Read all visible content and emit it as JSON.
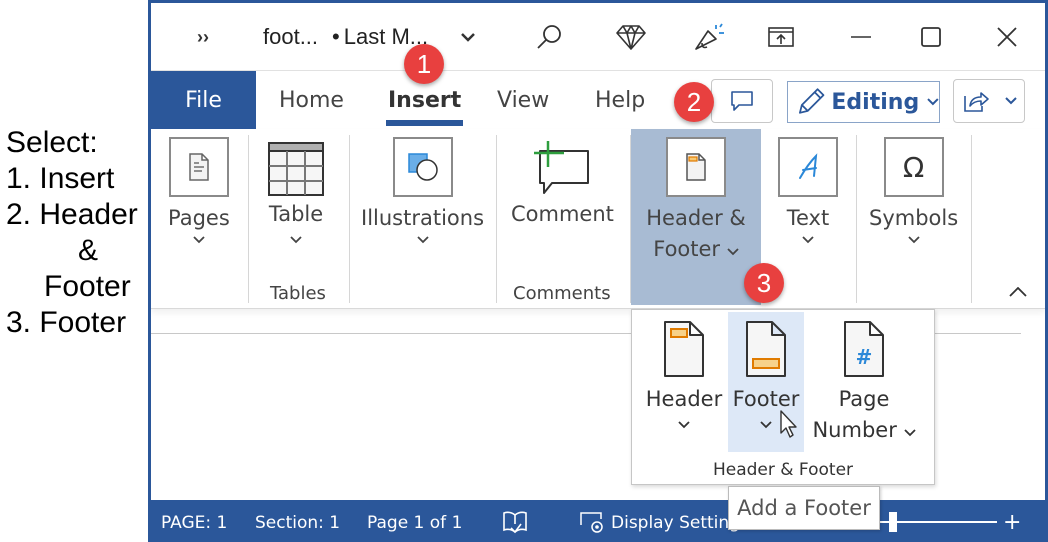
{
  "instructions": {
    "title": "Select:",
    "step1": "1. Insert",
    "step2a": "2. Header",
    "step2b": "&",
    "step2c": "Footer",
    "step3": "3. Footer"
  },
  "titlebar": {
    "more": "››",
    "doc_name": "foot...",
    "separator": "•",
    "save_status": "Last M...",
    "icons": [
      "search-icon",
      "diamond-icon",
      "megaphone-icon",
      "restore-ribbon-icon",
      "minimize-icon",
      "maximize-icon",
      "close-icon"
    ]
  },
  "tabs": {
    "file": "File",
    "home": "Home",
    "insert": "Insert",
    "view": "View",
    "help": "Help",
    "active": "Insert"
  },
  "toolbar_right": {
    "editing_label": "Editing"
  },
  "ribbon": {
    "pages": "Pages",
    "table": "Table",
    "tables_group": "Tables",
    "illustrations": "Illustrations",
    "comment": "Comment",
    "comments_group": "Comments",
    "header_footer_line1": "Header &",
    "header_footer_line2": "Footer",
    "text": "Text",
    "symbols": "Symbols"
  },
  "dropdown": {
    "header": "Header",
    "footer": "Footer",
    "page_number_line1": "Page",
    "page_number_line2": "Number",
    "group_label": "Header & Footer"
  },
  "tooltip": "Add a Footer",
  "statusbar": {
    "page": "PAGE: 1",
    "section": "Section: 1",
    "page_of": "Page 1 of 1",
    "display_settings": "Display Settings",
    "zoom_plus": "+"
  },
  "badges": [
    "1",
    "2",
    "3"
  ],
  "colors": {
    "brand": "#2b579a",
    "badge": "#e8403f",
    "highlight": "#a8bbd3",
    "hover": "#dde8f7",
    "accent_orange": "#e07b00",
    "accent_blue": "#2b88d8",
    "accent_green": "#2e9e3e"
  }
}
